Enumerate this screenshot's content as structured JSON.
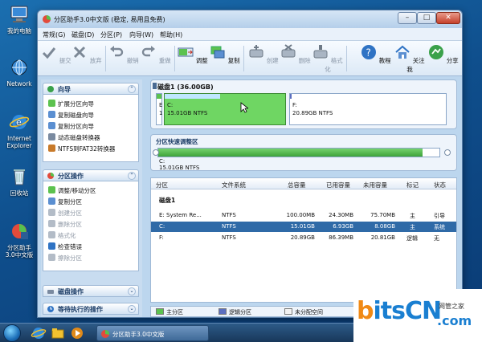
{
  "desktop": {
    "icons": [
      {
        "label": "我的电脑"
      },
      {
        "label": "Network"
      },
      {
        "label": "Internet Explorer"
      },
      {
        "label": "回收站"
      },
      {
        "label": "分区助手3.0中文版"
      }
    ]
  },
  "window": {
    "title": "分区助手3.0中文版 (稳定, 易用且免费)"
  },
  "menu": [
    "常规(G)",
    "磁盘(D)",
    "分区(P)",
    "向导(W)",
    "帮助(H)"
  ],
  "toolbar": {
    "undo": "提交",
    "discard": "放弃",
    "revert": "撤销",
    "redo": "重做",
    "adjust": "调整",
    "copy": "复制",
    "create": "创建",
    "delete": "删除",
    "format": "格式化",
    "tutorial": "教程",
    "follow": "关注我",
    "share": "分享"
  },
  "left": {
    "wizard": {
      "title": "向导",
      "items": [
        "扩展分区向导",
        "复制磁盘向导",
        "复制分区向导",
        "动态磁盘转换器",
        "NTFS到FAT32转换器"
      ]
    },
    "partition_ops": {
      "title": "分区操作",
      "items": [
        "调整/移动分区",
        "复制分区",
        "创建分区",
        "删除分区",
        "格式化",
        "检查错误",
        "擦除分区"
      ]
    },
    "disk_ops": {
      "title": "磁盘操作"
    },
    "pending": {
      "title": "等待执行的操作"
    }
  },
  "disk_map": {
    "title": "磁盘1 (36.00GB)",
    "parts": [
      {
        "letter": "E",
        "num": "1"
      },
      {
        "name": "C:",
        "size": "15.01GB NTFS",
        "used_fraction": 0.46
      },
      {
        "name": "F:",
        "size": "20.89GB NTFS",
        "used_fraction": 0.004
      }
    ]
  },
  "selected": {
    "title": "分区快速调整区",
    "name": "C:",
    "size": "15.01GB NTFS",
    "fill_fraction": 0.94
  },
  "table": {
    "headers": [
      "分区",
      "文件系统",
      "总容量",
      "已用容量",
      "未用容量",
      "标记",
      "状态"
    ],
    "disk_label": "磁盘1",
    "rows": [
      {
        "partition": "E:  System Re...",
        "fs": "NTFS",
        "total": "100.00MB",
        "used": "24.30MB",
        "free": "75.70MB",
        "flag": "主",
        "status": "引导"
      },
      {
        "partition": "C:",
        "fs": "NTFS",
        "total": "15.01GB",
        "used": "6.93GB",
        "free": "8.08GB",
        "flag": "主",
        "status": "系统"
      },
      {
        "partition": "F:",
        "fs": "NTFS",
        "total": "20.89GB",
        "used": "86.39MB",
        "free": "20.81GB",
        "flag": "逻辑",
        "status": "无"
      }
    ]
  },
  "legend": {
    "primary": "主分区",
    "logical": "逻辑分区",
    "unallocated": "未分配空间"
  },
  "taskbar": {
    "task": "分区助手3.0中文版"
  },
  "watermark": {
    "brand_b": "b",
    "brand_rest": "itsCN",
    "sub": "网管之家",
    "com": ".com"
  },
  "colors": {
    "primary_part": "#5cc24f",
    "logical_part": "#5b6fc0",
    "unallocated": "#f2f2f2",
    "selection": "#2f6aa7"
  }
}
